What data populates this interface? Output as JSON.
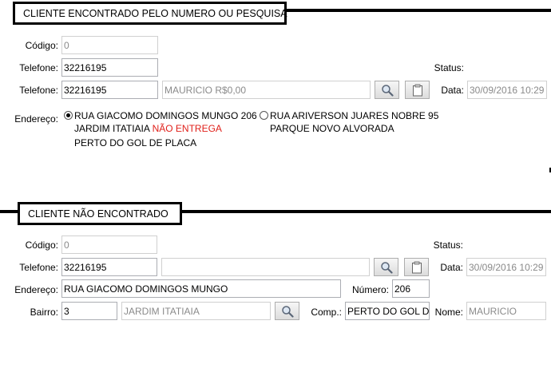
{
  "section1": {
    "title": "CLIENTE ENCONTRADO PELO NUMERO OU PESQUISA",
    "codigo_label": "Código:",
    "codigo_value": "0",
    "telefone1_label": "Telefone:",
    "telefone1_value": "32216195",
    "telefone2_label": "Telefone:",
    "telefone2_value": "32216195",
    "cliente_value": "MAURICIO R$0,00",
    "status_label": "Status:",
    "data_label": "Data:",
    "data_value": "30/09/2016 10:29",
    "endereco_label": "Endereço:",
    "address_options": [
      {
        "selected": true,
        "line1": "RUA GIACOMO DOMINGOS MUNGO 206",
        "line2_prefix": "JARDIM ITATIAIA ",
        "line2_alert": "NÃO ENTREGA",
        "line3": "PERTO DO GOL DE PLACA"
      },
      {
        "selected": false,
        "line1": "RUA ARIVERSON JUARES NOBRE 95",
        "line2_prefix": "PARQUE NOVO ALVORADA"
      }
    ]
  },
  "section2": {
    "title": "CLIENTE NÃO ENCONTRADO",
    "codigo_label": "Código:",
    "codigo_value": "0",
    "telefone_label": "Telefone:",
    "telefone_value": "32216195",
    "cliente_value": "",
    "status_label": "Status:",
    "data_label": "Data:",
    "data_value": "30/09/2016 10:29",
    "endereco_label": "Endereço:",
    "endereco_value": "RUA GIACOMO DOMINGOS MUNGO",
    "numero_label": "Número:",
    "numero_value": "206",
    "bairro_label": "Bairro:",
    "bairro_code": "3",
    "bairro_name": "JARDIM ITATIAIA",
    "comp_label": "Comp.:",
    "comp_value": "PERTO DO GOL DE",
    "nome_label": "Nome:",
    "nome_value": "MAURICIO"
  },
  "icons": {
    "search": "magnifier-icon",
    "clipboard": "clipboard-icon",
    "alert_color": "#e0201a"
  }
}
